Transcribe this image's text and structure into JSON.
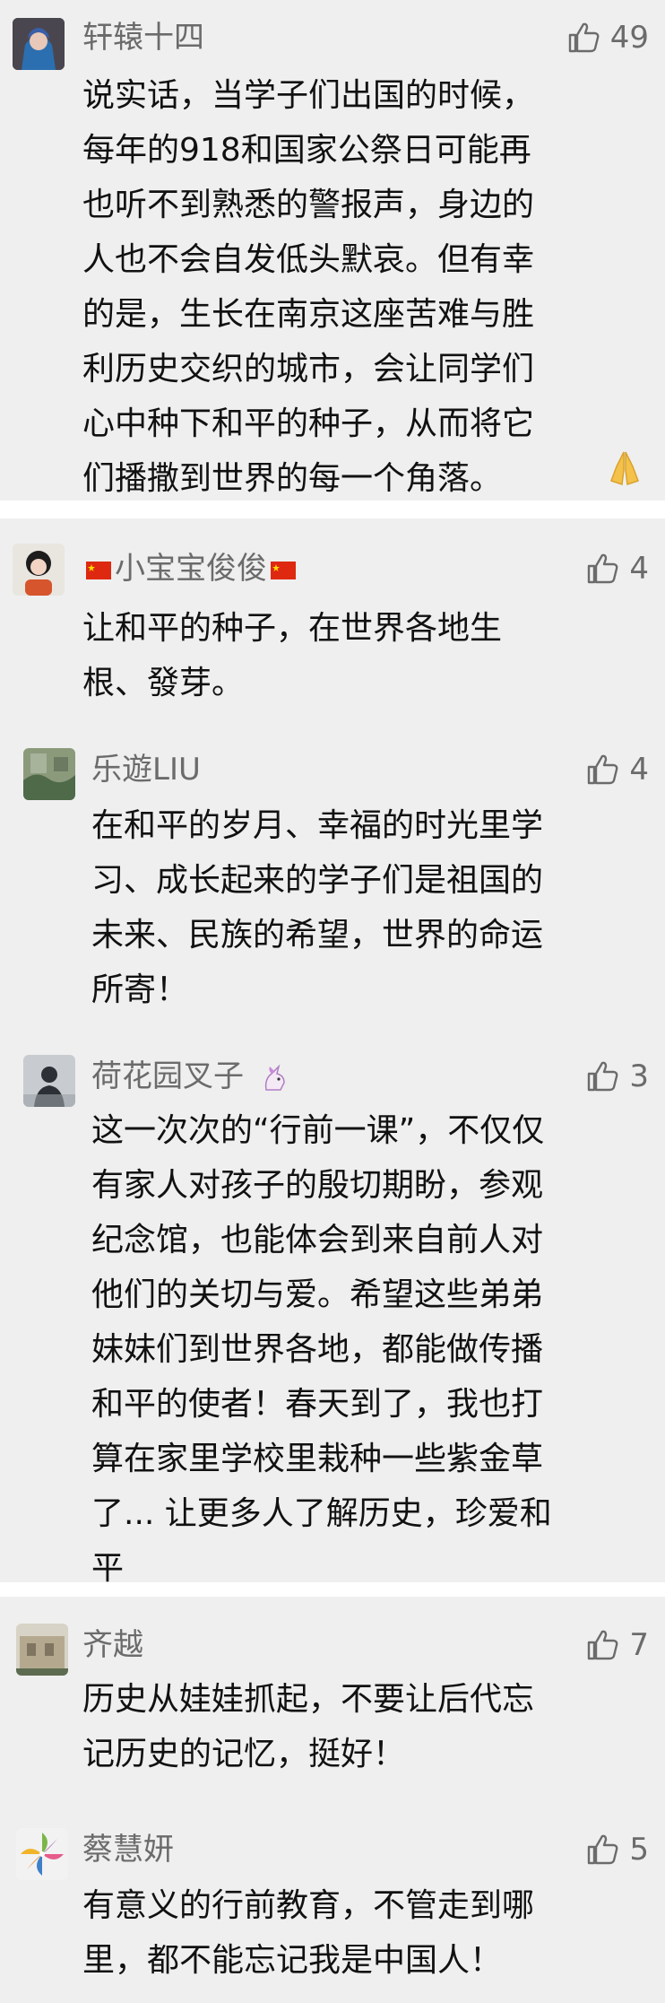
{
  "comments": [
    {
      "name": "轩辕十四",
      "likes": "49",
      "text": "说实话，当学子们出国的时候，\n每年的918和国家公祭日可能再\n也听不到熟悉的警报声，身边的\n人也不会自发低头默哀。但有幸\n的是，生长在南京这座苦难与胜\n利历史交织的城市，会让同学们\n心中种下和平的种子，从而将它\n们播撒到世界的每一个角落。"
    },
    {
      "name": "小宝宝俊俊",
      "likes": "4",
      "text": "让和平的种子，在世界各地生\n根、發芽。"
    },
    {
      "name": "乐遊LIU",
      "likes": "4",
      "text": "在和平的岁月、幸福的时光里学\n习、成长起来的学子们是祖国的\n未来、民族的希望，世界的命运\n所寄！"
    },
    {
      "name": "荷花园叉子",
      "likes": "3",
      "text": "这一次次的“行前一课”，不仅仅\n有家人对孩子的殷切期盼，参观\n纪念馆，也能体会到来自前人对\n他们的关切与爱。希望这些弟弟\n妹妹们到世界各地，都能做传播\n和平的使者！春天到了，我也打\n算在家里学校里栽种一些紫金草\n了... 让更多人了解历史，珍爱和\n平"
    },
    {
      "name": "齐越",
      "likes": "7",
      "text": "历史从娃娃抓起，不要让后代忘\n记历史的记忆，挺好！"
    },
    {
      "name": "蔡慧妍",
      "likes": "5",
      "text": "有意义的行前教育，不管走到哪\n里，都不能忘记我是中国人！"
    }
  ],
  "icons": {
    "like": "thumbs-up-icon",
    "pray": "folded-hands-emoji",
    "flag": "china-flag-emoji",
    "unicorn": "unicorn-emoji"
  },
  "colors": {
    "background": "#efefef",
    "name": "#6b6b6b",
    "text": "#111111"
  }
}
